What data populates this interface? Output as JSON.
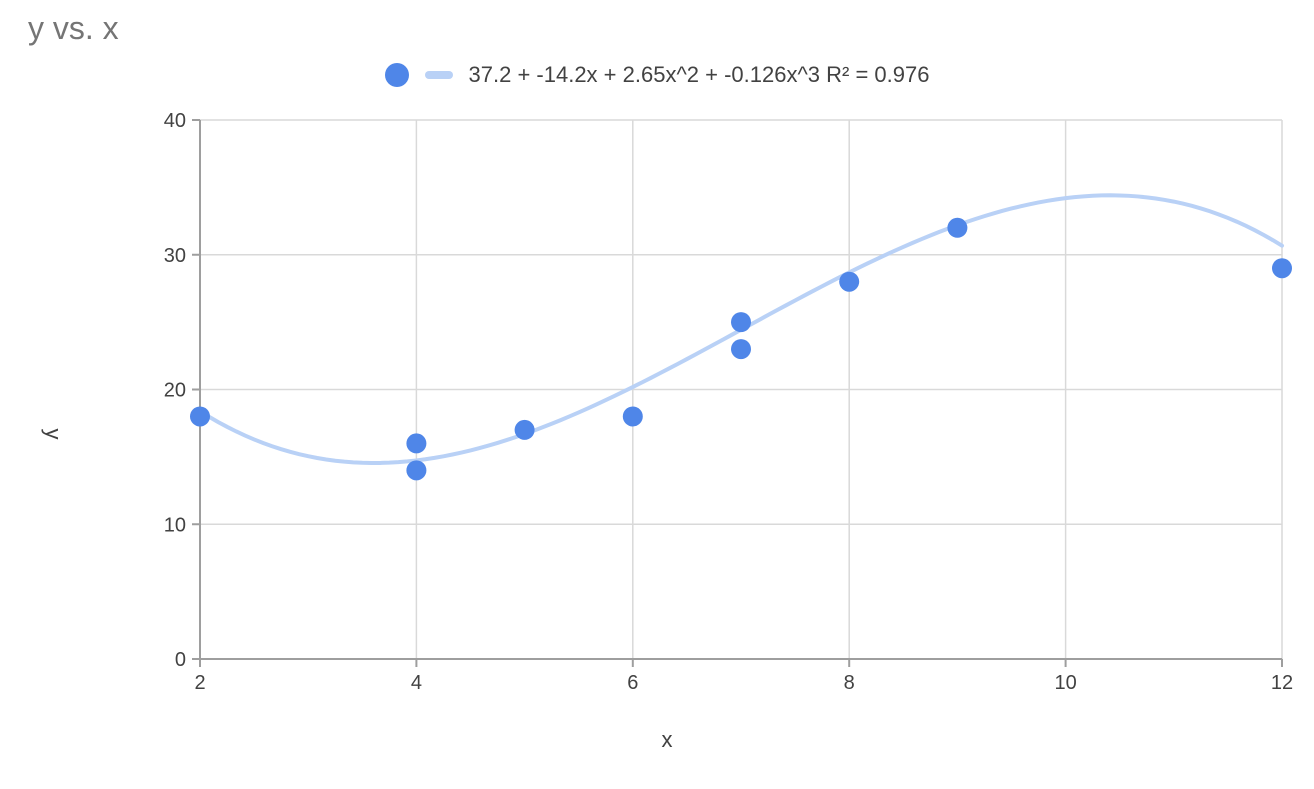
{
  "title": "y vs. x",
  "legend": {
    "formula": "37.2 + -14.2x + 2.65x^2 + -0.126x^3 R² = 0.976"
  },
  "axes": {
    "xlabel": "x",
    "ylabel": "y",
    "x": {
      "min": 2,
      "max": 12,
      "ticks": [
        2,
        4,
        6,
        8,
        10,
        12
      ]
    },
    "y": {
      "min": 0,
      "max": 40,
      "ticks": [
        0,
        10,
        20,
        30,
        40
      ]
    }
  },
  "curve_formula": {
    "a0": 37.2,
    "a1": -14.2,
    "a2": 2.65,
    "a3": -0.126
  },
  "points": [
    {
      "x": 2,
      "y": 18
    },
    {
      "x": 4,
      "y": 16
    },
    {
      "x": 4,
      "y": 14
    },
    {
      "x": 5,
      "y": 17
    },
    {
      "x": 6,
      "y": 18
    },
    {
      "x": 7,
      "y": 25
    },
    {
      "x": 7,
      "y": 23
    },
    {
      "x": 8,
      "y": 28
    },
    {
      "x": 9,
      "y": 32
    },
    {
      "x": 12,
      "y": 29
    }
  ],
  "chart_data": {
    "type": "scatter",
    "title": "y vs. x",
    "xlabel": "x",
    "ylabel": "y",
    "xlim": [
      2,
      12
    ],
    "ylim": [
      0,
      40
    ],
    "x_ticks": [
      2,
      4,
      6,
      8,
      10,
      12
    ],
    "y_ticks": [
      0,
      10,
      20,
      30,
      40
    ],
    "series": [
      {
        "name": "",
        "type": "scatter",
        "x": [
          2,
          4,
          4,
          5,
          6,
          7,
          7,
          8,
          9,
          12
        ],
        "y": [
          18,
          16,
          14,
          17,
          18,
          25,
          23,
          28,
          32,
          29
        ]
      },
      {
        "name": "37.2 + -14.2x + 2.65x^2 + -0.126x^3 R² = 0.976",
        "type": "line",
        "formula": "y = 37.2 - 14.2*x + 2.65*x^2 - 0.126*x^3",
        "r_squared": 0.976
      }
    ],
    "grid": true,
    "legend_position": "top"
  }
}
